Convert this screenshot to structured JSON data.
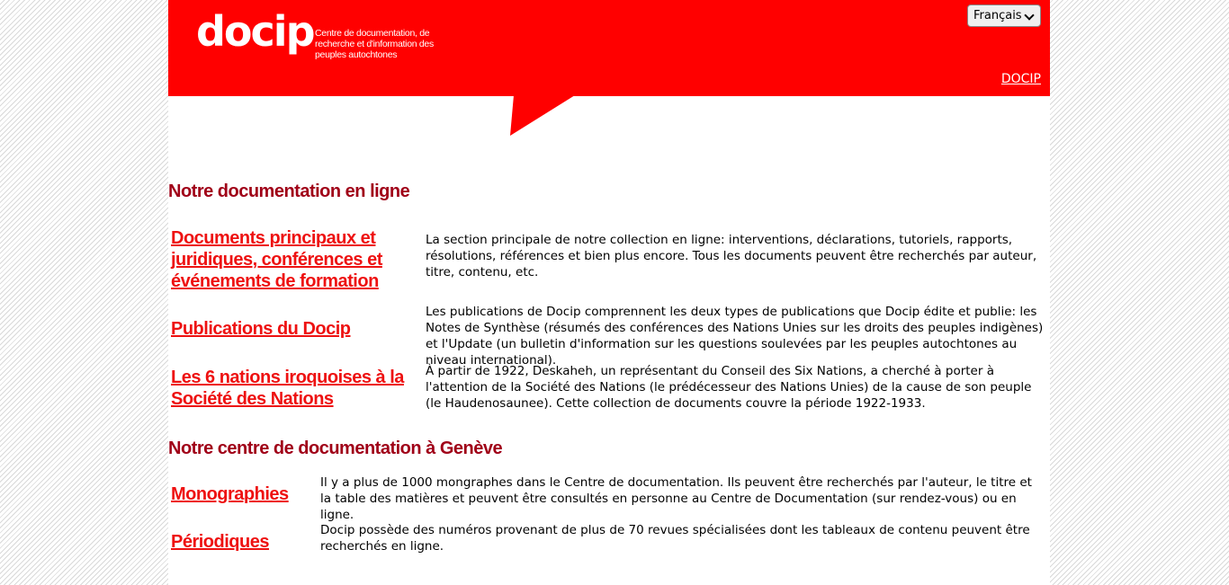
{
  "header": {
    "logo_text": "docip",
    "tagline": "Centre de documentation, de recherche et d'information des peuples autochtones",
    "language_select": {
      "selected": "Français"
    },
    "top_link": "DOCIP"
  },
  "online": {
    "heading": "Notre documentation en ligne",
    "items": [
      {
        "title": "Documents principaux et juridiques, conférences et événements de formation",
        "description": "La section principale de notre collection en ligne: interventions, déclarations, tutoriels, rapports, résolutions, références et bien plus encore. Tous les documents peuvent être recherchés par auteur, titre, contenu, etc."
      },
      {
        "title": "Publications du Docip",
        "description": "Les publications de Docip comprennent les deux types de publications que Docip édite et publie: les Notes de Synthèse (résumés des conférences des Nations Unies sur les droits des peuples indigènes) et l'Update (un bulletin d'information sur les questions soulevées par les peuples autochtones au niveau international)."
      },
      {
        "title": "Les 6 nations iroquoises à la Société des Nations",
        "description": "À partir de 1922, Deskaheh, un représentant du Conseil des Six Nations, a cherché à porter à l'attention de la Société des Nations (le prédécesseur des Nations Unies) de la cause de son peuple (le Haudenosaunee). Cette collection de documents couvre la période 1922-1933."
      }
    ]
  },
  "geneva": {
    "heading": "Notre centre de documentation à Genève",
    "items": [
      {
        "title": "Monographies",
        "description": "Il y a plus de 1000 mongraphes dans le Centre de documentation. Ils peuvent être recherchés par l'auteur, le titre et la table des matières et peuvent être consultés en personne au Centre de Documentation (sur rendez-vous) ou en ligne."
      },
      {
        "title": "Périodiques",
        "description": "Docip possède des numéros provenant de plus de 70 revues spécialisées dont les tableaux de contenu peuvent être recherchés en ligne."
      }
    ]
  }
}
